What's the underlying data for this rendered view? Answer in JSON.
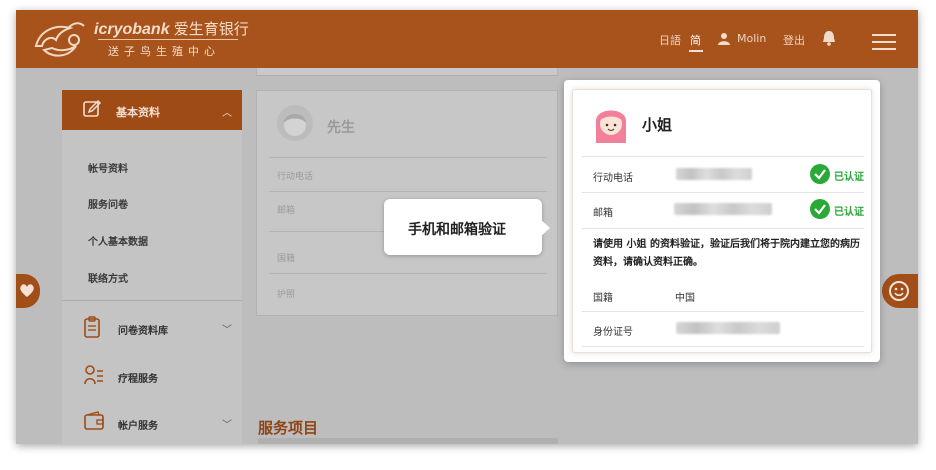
{
  "header": {
    "brand_en": "icryobank",
    "brand_cn": "爱生育银行",
    "slogan": "送子鸟生殖中心",
    "nav": {
      "lang_trad": "日語",
      "lang_simp": "简",
      "username": "Molin",
      "logout": "登出"
    },
    "colors": {
      "bar": "#a8531c"
    }
  },
  "sidebar": {
    "section_title": "基本资料",
    "sub_items": [
      "帐号资料",
      "服务问卷",
      "个人基本数据",
      "联络方式"
    ],
    "sections": [
      {
        "label": "问卷资料库",
        "icon": "clipboard-icon"
      },
      {
        "label": "疗程服务",
        "icon": "user-list-icon"
      },
      {
        "label": "帐户服务",
        "icon": "wallet-icon"
      }
    ]
  },
  "middle_card": {
    "title": "先生",
    "rows": [
      "行动电话",
      "邮箱",
      "国籍",
      "护照"
    ]
  },
  "service": {
    "title": "服务项目"
  },
  "callout": {
    "text": "手机和邮箱验证"
  },
  "focus_card": {
    "title": "小姐",
    "phone_label": "行动电话",
    "email_label": "邮箱",
    "verified_label": "已认证",
    "notice": "请使用 小姐 的资料验证，验证后我们将于院内建立您的病历资料，请确认资料正确。",
    "nationality_label": "国籍",
    "nationality_value": "中国",
    "id_label": "身份证号"
  }
}
